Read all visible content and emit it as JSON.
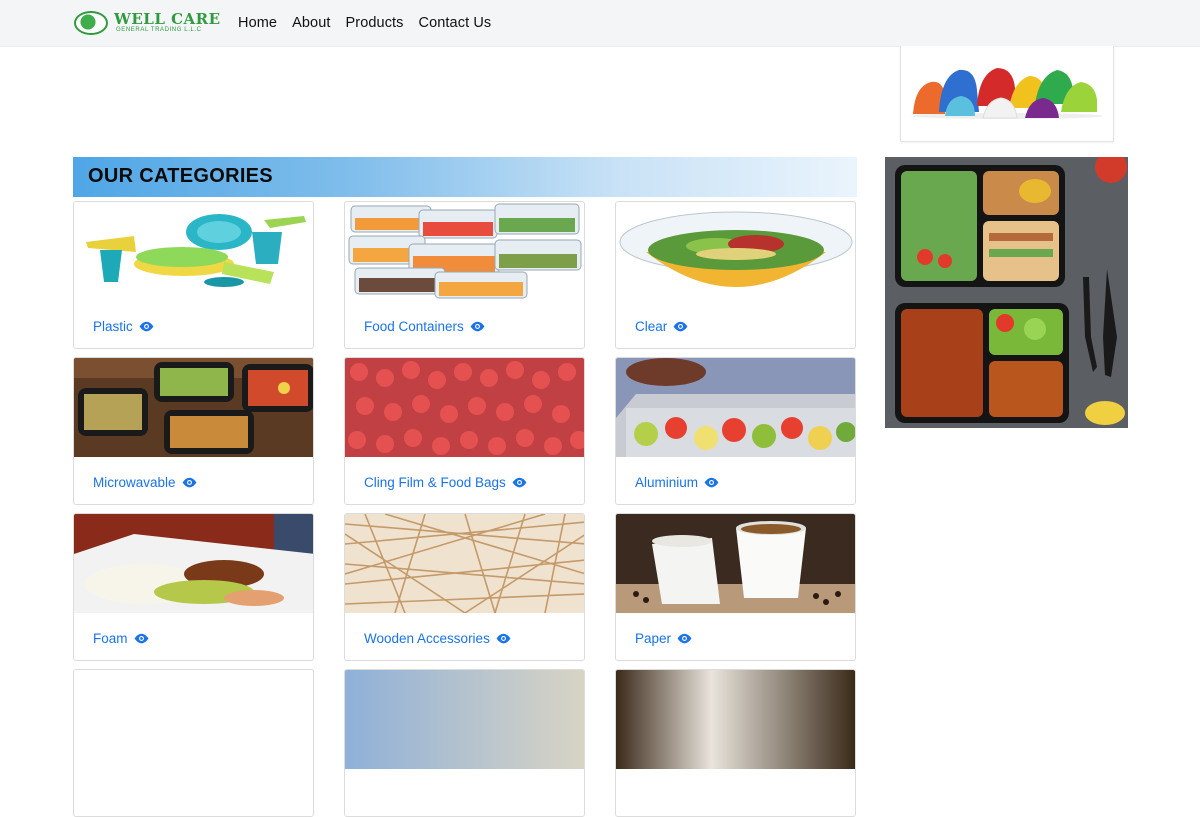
{
  "brand": {
    "name": "WELL CARE",
    "subtitle": "GENERAL TRADING L.L.C"
  },
  "nav": {
    "items": [
      "Home",
      "About",
      "Products",
      "Contact Us"
    ]
  },
  "section": {
    "title": "OUR CATEGORIES"
  },
  "categories": [
    {
      "label": "Plastic"
    },
    {
      "label": "Food Containers"
    },
    {
      "label": "Clear"
    },
    {
      "label": "Microwavable"
    },
    {
      "label": "Cling Film & Food Bags"
    },
    {
      "label": "Aluminium"
    },
    {
      "label": "Foam"
    },
    {
      "label": "Wooden Accessories"
    },
    {
      "label": "Paper"
    }
  ],
  "icons": {
    "view": "eye-icon",
    "logo": "globe-logo-icon"
  },
  "colors": {
    "brand_green": "#2e9b3e",
    "link_blue": "#1a73e8",
    "header_blue": "#4fa6e6"
  }
}
